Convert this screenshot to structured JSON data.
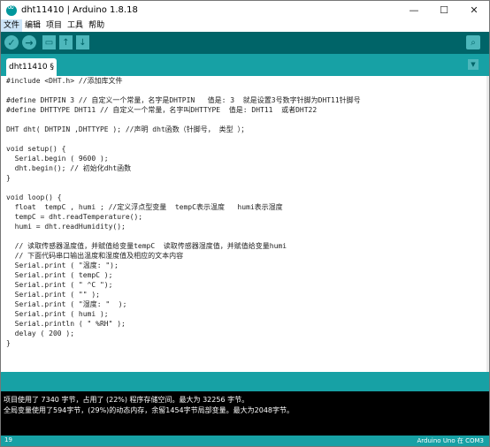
{
  "window": {
    "title": "dht11410 | Arduino 1.8.18",
    "minimize_glyph": "—",
    "maximize_glyph": "☐",
    "close_glyph": "✕"
  },
  "menu": [
    "文件",
    "编辑",
    "项目",
    "工具",
    "帮助"
  ],
  "toolbar": {
    "verify_glyph": "✓",
    "upload_glyph": "→",
    "new_glyph": "▭",
    "open_glyph": "↑",
    "save_glyph": "↓",
    "serial_glyph": "⌕"
  },
  "tabs": [
    {
      "label": "dht11410 §"
    }
  ],
  "tab_menu_glyph": "▼",
  "code": [
    "#include <DHT.h> //添加库文件",
    "",
    "#define DHTPIN 3 // 自定义一个常量，名字是DHTPIN   值是: 3  就是设置3号数字针脚为DHT11针脚号",
    "#define DHTTYPE DHT11 // 自定义一个常量，名字叫DHTTYPE  值是: DHT11  或者DHT22",
    "",
    "DHT dht( DHTPIN ,DHTTYPE ); //声明 dht函数（针脚号， 类型 ）；",
    "",
    "void setup() {",
    "  Serial.begin ( 9600 );",
    "  dht.begin(); // 初始化dht函数",
    "}",
    "",
    "void loop() {",
    "  float  tempC , humi ; //定义浮点型变量  tempC表示温度   humi表示湿度",
    "  tempC = dht.readTemperature();",
    "  humi = dht.readHumidity();",
    "",
    "  // 读取传感器温度值，并赋值给变量tempC  读取传感器湿度值，并赋值给变量humi",
    "  // 下面代码串口输出温度和湿度值及相应的文本内容",
    "  Serial.print ( \"温度: \");",
    "  Serial.print ( tempC );",
    "  Serial.print ( \" ^C \");",
    "  Serial.print ( \"\" );",
    "  Serial.print ( \"湿度: \"  );",
    "  Serial.print ( humi );",
    "  Serial.println ( \" %RH\" );",
    "  delay ( 200 );",
    "}"
  ],
  "console": [
    "项目使用了 7340 字节，占用了 (22%) 程序存储空间。最大为 32256 字节。",
    "全局变量使用了594字节，(29%)的动态内存，余留1454字节局部变量。最大为2048字节。"
  ],
  "status": {
    "line_number": "19",
    "board": "Arduino Uno 在 COM3"
  },
  "colors": {
    "toolbar": "#006468",
    "accent": "#17a1a5",
    "button": "#4db7bb",
    "console_bg": "#000000"
  }
}
